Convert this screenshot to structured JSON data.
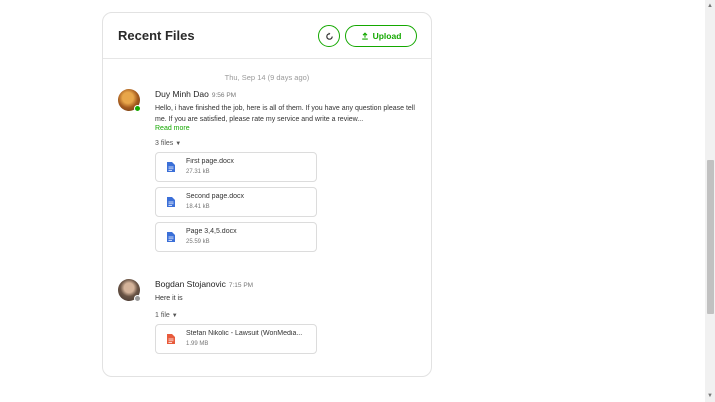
{
  "panel": {
    "title": "Recent Files",
    "upload_label": "Upload",
    "date_separator": "Thu, Sep 14 (9 days ago)"
  },
  "messages": [
    {
      "sender": "Duy Minh Dao",
      "time": "9:56 PM",
      "status_color": "#14a800",
      "text": "Hello, i have finished the job, here is all of them. If you have any question please tell me. If you are satisfied, please rate my service and write a review...",
      "read_more": "Read more",
      "files_toggle": "3 files",
      "files": [
        {
          "name": "First page.docx",
          "size": "27.31 kB",
          "icon": "docx-icon"
        },
        {
          "name": "Second page.docx",
          "size": "18.41 kB",
          "icon": "docx-icon"
        },
        {
          "name": "Page 3,4,5.docx",
          "size": "25.59 kB",
          "icon": "docx-icon"
        }
      ]
    },
    {
      "sender": "Bogdan Stojanovic",
      "time": "7:15 PM",
      "status_color": "#9a9a9a",
      "text": "Here it is",
      "files_toggle": "1 file",
      "files": [
        {
          "name": "Stefan Nikolic - Lawsuit (WonMedia...",
          "size": "1.99 MB",
          "icon": "pdf-icon"
        }
      ]
    }
  ],
  "colors": {
    "accent": "#14a800",
    "docx_icon": "#3b6fd8",
    "pdf_icon": "#e85b3c"
  }
}
